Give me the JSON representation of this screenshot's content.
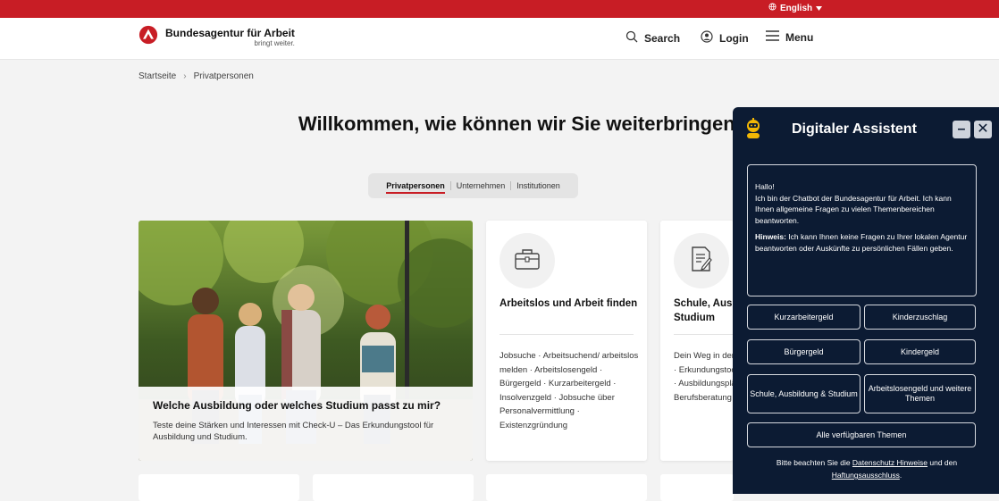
{
  "colors": {
    "brand_red": "#c81d25",
    "assistant_bg": "#0c1b33",
    "page_bg": "#f3f3f3"
  },
  "topbar": {
    "language": "English",
    "globe_icon": "globe-icon",
    "caret_icon": "caret-down-icon"
  },
  "header": {
    "brand_name": "Bundesagentur für Arbeit",
    "brand_tagline": "bringt weiter.",
    "search_label": "Search",
    "login_label": "Login",
    "menu_label": "Menu"
  },
  "breadcrumb": {
    "items": [
      "Startseite",
      "Privatpersonen"
    ]
  },
  "main": {
    "title": "Willkommen, wie können wir Sie weiterbringen?",
    "tabs": [
      {
        "label": "Privatpersonen",
        "active": true
      },
      {
        "label": "Unternehmen",
        "active": false
      },
      {
        "label": "Institutionen",
        "active": false
      }
    ]
  },
  "hero": {
    "title": "Welche Ausbildung oder welches Studium passt zu mir?",
    "text": "Teste deine Stärken und Interessen mit Check-U – Das Erkundungstool für Ausbildung und Studium."
  },
  "cards": [
    {
      "icon": "briefcase-icon",
      "title": "Arbeitslos und Arbeit finden",
      "links_text": "Jobsuche · Arbeitsuchend/ arbeitslos melden · Arbeitslosengeld · Bürgergeld · Kurzarbeitergeld · Insolvenzgeld · Jobsuche über Personalvermittlung · Existenzgründung"
    },
    {
      "icon": "document-pen-icon",
      "title": "Schule, Ausbildung und Studium",
      "links_text": "Dein Weg in den Beruf · zum Studium · Erkundungstool · Ausbildungsplätze · Ausbildungsplätze · Studienplätze · Berufsberatung"
    }
  ],
  "assistant": {
    "title": "Digitaler Assistent",
    "minimize_label": "–",
    "close_label": "✕",
    "greeting": "Hallo!",
    "intro": "Ich bin der Chatbot der Bundesagentur für Arbeit. Ich kann Ihnen allgemeine Fragen zu vielen Themenbereichen beantworten.",
    "hint_label": "Hinweis:",
    "hint_text": " Ich kann Ihnen keine Fragen zu Ihrer lokalen Agentur beantworten oder Auskünfte zu persönlichen Fällen geben.",
    "topics": [
      "Kurzarbeitergeld",
      "Kinderzuschlag",
      "Bürgergeld",
      "Kindergeld",
      "Schule, Ausbildung & Studium",
      "Arbeitslosengeld und weitere Themen"
    ],
    "all_topics": "Alle verfügbaren Themen",
    "disclaimer_pre": "Bitte beachten Sie die ",
    "disclaimer_link1": "Datenschutz Hinweise",
    "disclaimer_mid": " und den ",
    "disclaimer_link2": "Haftungsausschluss",
    "disclaimer_post": "."
  }
}
